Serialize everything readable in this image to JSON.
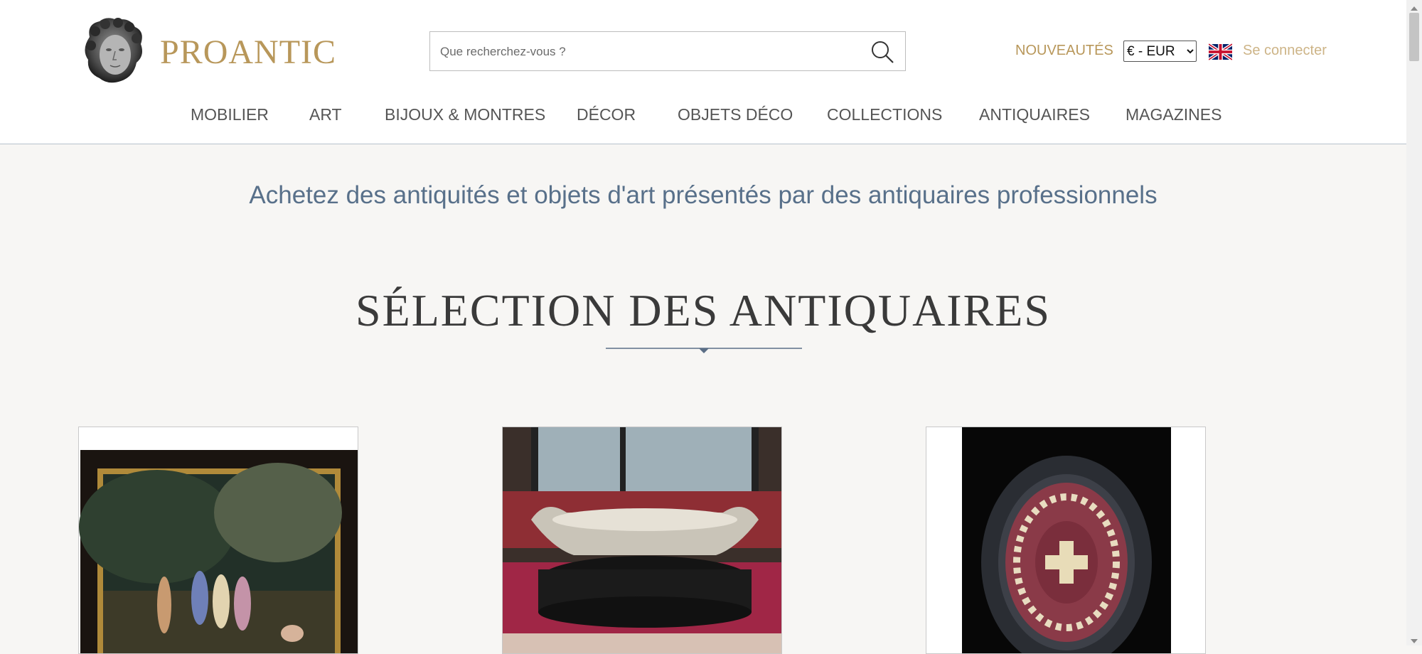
{
  "header": {
    "brand": "PROANTIC",
    "search_placeholder": "Que recherchez-vous ?",
    "new_arrivals": "NOUVEAUTÉS",
    "currency_selected": "€ - EUR",
    "language_flag": "uk-flag-icon",
    "login": "Se connecter",
    "nav": [
      "MOBILIER",
      "ART",
      "BIJOUX & MONTRES",
      "DÉCOR",
      "OBJETS DÉCO",
      "COLLECTIONS",
      "ANTIQUAIRES",
      "MAGAZINES"
    ]
  },
  "main": {
    "tagline": "Achetez des antiquités et objets d'art présentés par des antiquaires professionnels",
    "section_title": "SÉLECTION DES ANTIQUAIRES"
  },
  "colors": {
    "brand_gold": "#b8975a",
    "tagline_blue": "#58708a",
    "background": "#f7f6f4"
  }
}
